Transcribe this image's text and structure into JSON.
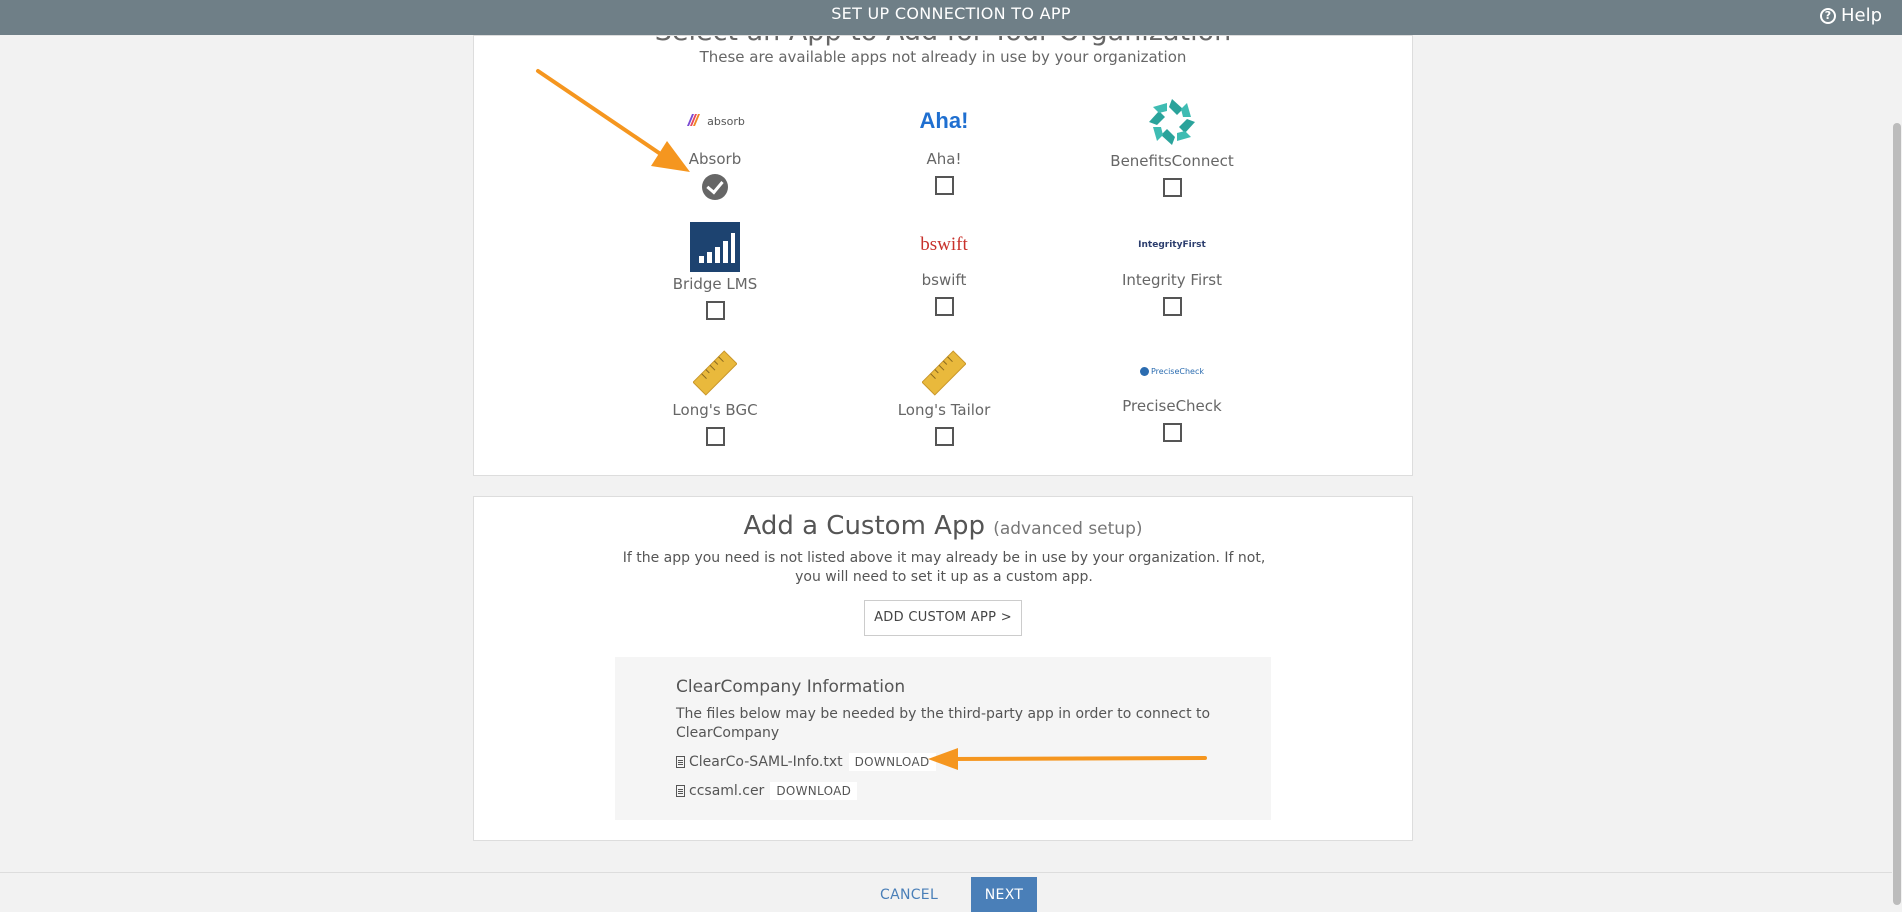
{
  "header": {
    "title": "SET UP CONNECTION TO APP",
    "help_label": "Help"
  },
  "select_section": {
    "title": "Select an App to Add for Your Organization",
    "subtitle": "These are available apps not already in use by your organization",
    "apps": [
      {
        "name": "Absorb",
        "logo_text": "absorb",
        "checked": true
      },
      {
        "name": "Aha!",
        "logo_text": "Aha!",
        "checked": false
      },
      {
        "name": "BenefitsConnect",
        "logo_text": "",
        "checked": false
      },
      {
        "name": "Bridge LMS",
        "logo_text": "",
        "checked": false
      },
      {
        "name": "bswift",
        "logo_text": "bswift",
        "checked": false
      },
      {
        "name": "Integrity First",
        "logo_text": "IntegrityFirst",
        "checked": false
      },
      {
        "name": "Long's BGC",
        "logo_text": "",
        "checked": false
      },
      {
        "name": "Long's Tailor",
        "logo_text": "",
        "checked": false
      },
      {
        "name": "PreciseCheck",
        "logo_text": "PreciseCheck",
        "checked": false
      }
    ]
  },
  "custom_section": {
    "title": "Add a Custom App",
    "advanced": "(advanced setup)",
    "description": "If the app you need is not listed above it may already be in use by your organization. If not, you will need to set it up as a custom app.",
    "button_label": "ADD CUSTOM APP >"
  },
  "info": {
    "title": "ClearCompany Information",
    "description": "The files below may be needed by the third-party app in order to connect to ClearCompany",
    "files": [
      {
        "name": "ClearCo-SAML-Info.txt",
        "action": "DOWNLOAD"
      },
      {
        "name": "ccsaml.cer",
        "action": "DOWNLOAD"
      }
    ]
  },
  "footer": {
    "cancel_label": "CANCEL",
    "next_label": "NEXT"
  },
  "colors": {
    "header_bg": "#6f7f87",
    "accent": "#4a7fb8",
    "arrow": "#f5961f"
  }
}
